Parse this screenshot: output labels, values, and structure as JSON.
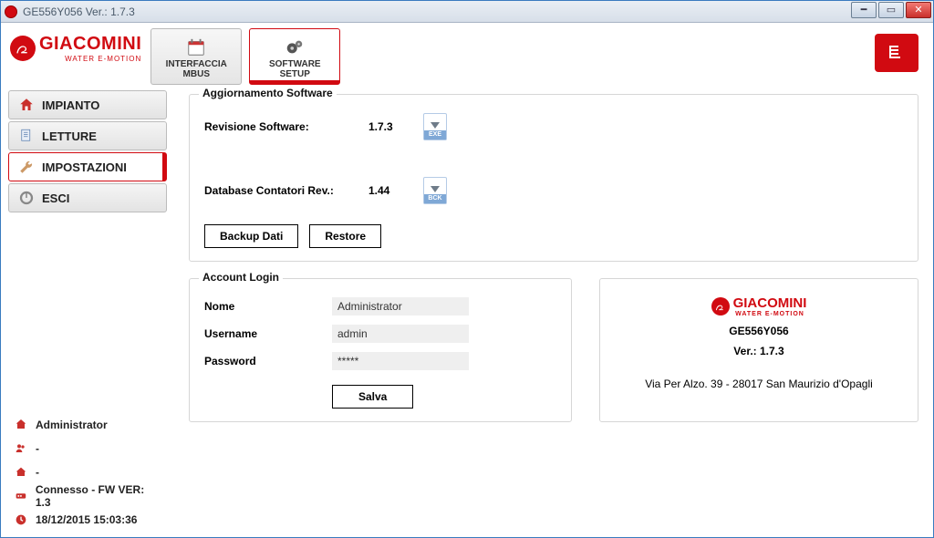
{
  "window": {
    "title": "GE556Y056 Ver.: 1.7.3"
  },
  "brand": {
    "name": "GIACOMINI",
    "tagline": "WATER E-MOTION"
  },
  "tabs": {
    "interfaccia": {
      "line1": "INTERFACCIA",
      "line2": "MBUS"
    },
    "software": {
      "line1": "SOFTWARE",
      "line2": "SETUP"
    }
  },
  "nav": {
    "impianto": "IMPIANTO",
    "letture": "LETTURE",
    "impostazioni": "IMPOSTAZIONI",
    "esci": "ESCI"
  },
  "status": {
    "user": "Administrator",
    "row2": "-",
    "row3": "-",
    "conn": "Connesso - FW VER: 1.3",
    "time": "18/12/2015 15:03:36"
  },
  "update_group": {
    "title": "Aggiornamento Software",
    "rev_label": "Revisione Software:",
    "rev_value": "1.7.3",
    "rev_badge": "EXE",
    "db_label": "Database Contatori Rev.:",
    "db_value": "1.44",
    "db_badge": "BCK",
    "backup_btn": "Backup Dati",
    "restore_btn": "Restore"
  },
  "login_group": {
    "title": "Account Login",
    "name_label": "Nome",
    "name_value": "Administrator",
    "user_label": "Username",
    "user_value": "admin",
    "pass_label": "Password",
    "pass_value": "*****",
    "save_btn": "Salva"
  },
  "about": {
    "model": "GE556Y056",
    "version": "Ver.: 1.7.3",
    "address": "Via Per Alzo. 39 - 28017 San Maurizio d'Opagli"
  }
}
